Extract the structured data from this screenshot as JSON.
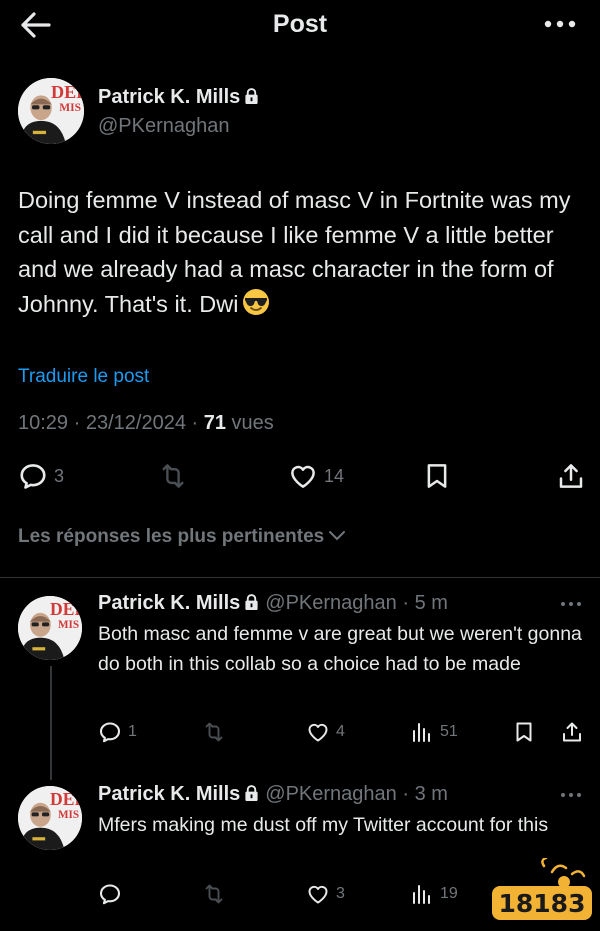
{
  "header": {
    "title": "Post"
  },
  "post": {
    "author": "Patrick K. Mills",
    "handle": "@PKernaghan",
    "text": "Doing femme V instead of masc V in Fortnite was my call and I did it because I like femme V a little better and we already had a masc character in the form of Johnny. That's it. Dwi",
    "translate": "Traduire le post",
    "time": "10:29",
    "date": "23/12/2024",
    "views_count": "71",
    "views_label": "vues",
    "replies": "3",
    "likes": "14"
  },
  "filter_label": "Les réponses les plus pertinentes",
  "replies": [
    {
      "author": "Patrick K. Mills",
      "handle": "@PKernaghan",
      "ago": "5 m",
      "text": "Both masc and femme v are great but we weren't gonna do both in this collab so a choice had to be made",
      "replies": "1",
      "likes": "4",
      "views": "51"
    },
    {
      "author": "Patrick K. Mills",
      "handle": "@PKernaghan",
      "ago": "3 m",
      "text": "Mfers making me dust off my Twitter account for this",
      "likes": "3",
      "views": "19"
    }
  ],
  "watermark": "18183",
  "colors": {
    "background": "#000000",
    "text": "#e7e9ea",
    "muted": "#71767b",
    "link": "#1d9bf0",
    "divider": "#2f3336"
  }
}
